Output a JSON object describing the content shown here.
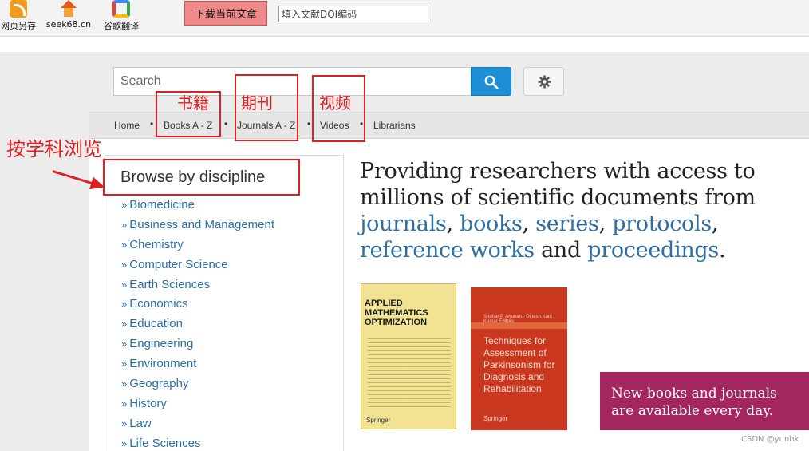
{
  "browser_toolbar": {
    "items": [
      {
        "label": "网页另存",
        "icon": "rss-save-icon"
      },
      {
        "label": "seek68.cn",
        "icon": "home-icon"
      },
      {
        "label": "谷歌翻译",
        "icon": "google-icon"
      }
    ],
    "download_button": "下载当前文章",
    "doi_placeholder": "填入文献DOI编码"
  },
  "search": {
    "placeholder": "Search",
    "button_icon": "search-icon",
    "settings_icon": "gear-icon"
  },
  "nav": {
    "links": [
      "Home",
      "Books A - Z",
      "Journals A - Z",
      "Videos",
      "Librarians"
    ]
  },
  "annotations": {
    "books": "书籍",
    "journals": "期刊",
    "videos": "视频",
    "browse": "按学科浏览",
    "color": "#e02020"
  },
  "sidebar": {
    "title": "Browse by discipline",
    "disciplines": [
      "Biomedicine",
      "Business and Management",
      "Chemistry",
      "Computer Science",
      "Earth Sciences",
      "Economics",
      "Education",
      "Engineering",
      "Environment",
      "Geography",
      "History",
      "Law",
      "Life Sciences"
    ]
  },
  "hero": {
    "line1": "Providing researchers with access to",
    "line2": "millions of scientific documents from",
    "journals": "journals",
    "books": "books",
    "series": "series",
    "protocols": "protocols",
    "reference_works": "reference works",
    "and": "and",
    "proceedings": "proceedings",
    "link_color": "#2f6ea2"
  },
  "books": [
    {
      "title": "APPLIED MATHEMATICS OPTIMIZATION",
      "publisher": "Springer",
      "color": "#f2e394"
    },
    {
      "title": "Techniques for Assessment of Parkinsonism for Diagnosis and Rehabilitation",
      "authors": "Sridhar P. Arjunan · Dinesh Kant Kumar Editors",
      "publisher": "Springer",
      "color": "#c9381e"
    }
  ],
  "promo": {
    "line1": "New books and journals",
    "line2": "are available every day.",
    "color": "#a3275e"
  },
  "watermark": "CSDN @yunhk"
}
